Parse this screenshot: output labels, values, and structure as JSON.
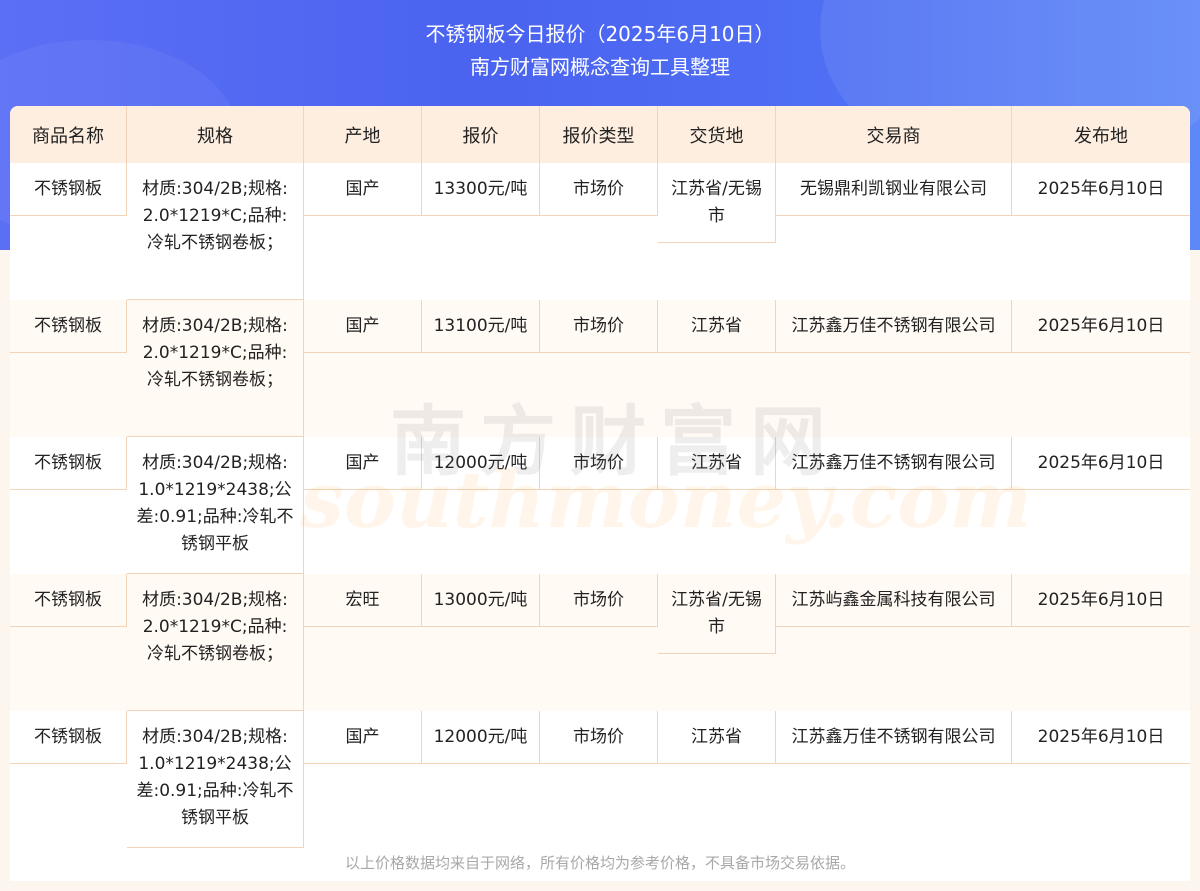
{
  "header": {
    "title": "不锈钢板今日报价（2025年6月10日）",
    "subtitle": "南方财富网概念查询工具整理"
  },
  "table": {
    "columns": [
      "商品名称",
      "规格",
      "产地",
      "报价",
      "报价类型",
      "交货地",
      "交易商",
      "发布地"
    ],
    "rows": [
      [
        "不锈钢板",
        "材质:304/2B;规格:2.0*1219*C;品种:冷轧不锈钢卷板；",
        "国产",
        "13300元/吨",
        "市场价",
        "江苏省/无锡市",
        "无锡鼎利凯钢业有限公司",
        "2025年6月10日"
      ],
      [
        "不锈钢板",
        "材质:304/2B;规格:2.0*1219*C;品种:冷轧不锈钢卷板；",
        "国产",
        "13100元/吨",
        "市场价",
        "江苏省",
        "江苏鑫万佳不锈钢有限公司",
        "2025年6月10日"
      ],
      [
        "不锈钢板",
        "材质:304/2B;规格:1.0*1219*2438;公差:0.91;品种:冷轧不锈钢平板",
        "国产",
        "12000元/吨",
        "市场价",
        "江苏省",
        "江苏鑫万佳不锈钢有限公司",
        "2025年6月10日"
      ],
      [
        "不锈钢板",
        "材质:304/2B;规格:2.0*1219*C;品种:冷轧不锈钢卷板；",
        "宏旺",
        "13000元/吨",
        "市场价",
        "江苏省/无锡市",
        "江苏屿鑫金属科技有限公司",
        "2025年6月10日"
      ],
      [
        "不锈钢板",
        "材质:304/2B;规格:1.0*1219*2438;公差:0.91;品种:冷轧不锈钢平板",
        "国产",
        "12000元/吨",
        "市场价",
        "江苏省",
        "江苏鑫万佳不锈钢有限公司",
        "2025年6月10日"
      ]
    ]
  },
  "watermark": {
    "cn": "南方财富网",
    "en": "southmoney.com"
  },
  "footer": {
    "note": "以上价格数据均来自于网络，所有价格均为参考价格，不具备市场交易依据。"
  },
  "colors": {
    "header_bg": "#4a63f0",
    "table_header_bg": "#fdeee0",
    "border": "#f3d4b8",
    "page_bg": "#fdf6ee"
  }
}
